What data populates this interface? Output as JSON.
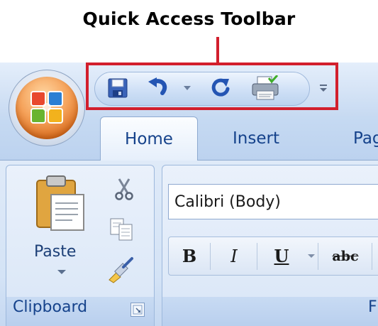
{
  "callout": {
    "title": "Quick Access Toolbar"
  },
  "qat": {
    "buttons": [
      {
        "name": "save-icon"
      },
      {
        "name": "undo-icon"
      },
      {
        "name": "undo-dropdown-icon"
      },
      {
        "name": "redo-icon"
      },
      {
        "name": "quick-print-icon"
      },
      {
        "name": "customize-qat-icon"
      }
    ]
  },
  "tabs": {
    "home": "Home",
    "insert": "Insert",
    "page": "Pag"
  },
  "clipboard": {
    "paste_label": "Paste",
    "group_label": "Clipboard"
  },
  "font": {
    "font_name": "Calibri (Body)",
    "bold": "B",
    "italic": "I",
    "underline": "U",
    "strikethrough": "abc",
    "group_label": "F"
  },
  "colors": {
    "callout_red": "#d21f2d",
    "tab_text": "#15428b",
    "ribbon_bg": "#d4e3f6"
  }
}
